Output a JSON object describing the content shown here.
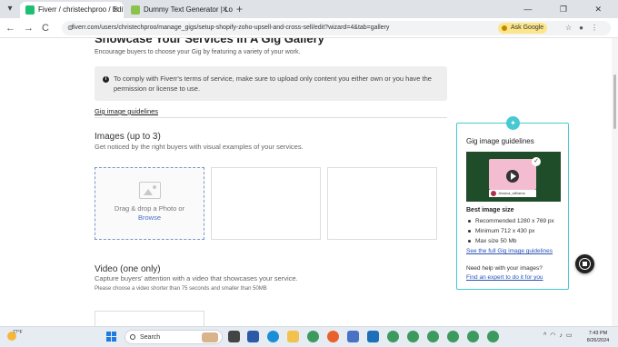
{
  "browser": {
    "tabs": [
      {
        "label": "Fiverr / christechproo / Edit Gig",
        "active": true,
        "favicon_color": "#1dbf73"
      },
      {
        "label": "Dummy Text Generator | Lore",
        "active": false,
        "favicon_color": "#8bc34a"
      }
    ],
    "new_tab_label": "+",
    "window_controls": [
      "—",
      "❐",
      "✕"
    ],
    "nav": {
      "back": "←",
      "forward": "→",
      "reload": "C"
    },
    "url": "fiverr.com/users/christechproo/manage_gigs/setup-shopify-zoho-upsell-and-cross-sell/edit?wizard=4&tab=gallery",
    "ask_google_label": "Ask Google"
  },
  "page": {
    "heading": "Showcase Your Services In A Gig Gallery",
    "intro": "Encourage buyers to choose your Gig by featuring a variety of your work.",
    "notice": "To comply with Fiverr's terms of service, make sure to upload only content you either own or you have the permission or license to use.",
    "guidelines_link": "Gig image guidelines",
    "images": {
      "title": "Images (up to 3)",
      "subtitle": "Get noticed by the right buyers with visual examples of your services.",
      "drop_text": "Drag & drop a Photo or",
      "browse": "Browse"
    },
    "video": {
      "title": "Video (one only)",
      "subtitle": "Capture buyers' attention with a video that showcases your service.",
      "note": "Please choose a video shorter than 75 seconds and smaller than 50MB"
    }
  },
  "panel": {
    "title": "Gig image guidelines",
    "thumb_name": "Jessica_williams",
    "best_size_title": "Best image size",
    "specs": [
      "Recommended 1280 x 769 px",
      "Minimum 712 x 430 px",
      "Max size 50 Mb"
    ],
    "see_full": "See the full Gig image guidelines",
    "help_question": "Need help with your images?",
    "expert_link": "Find an expert to do it for you"
  },
  "taskbar": {
    "weather_temp": "77°F",
    "search_label": "Search",
    "time": "7:43 PM",
    "date": "8/26/2024"
  },
  "colors": {
    "accent_teal": "#46c9d0",
    "link_blue": "#2a51b5",
    "drop_border": "#7d93c9"
  }
}
